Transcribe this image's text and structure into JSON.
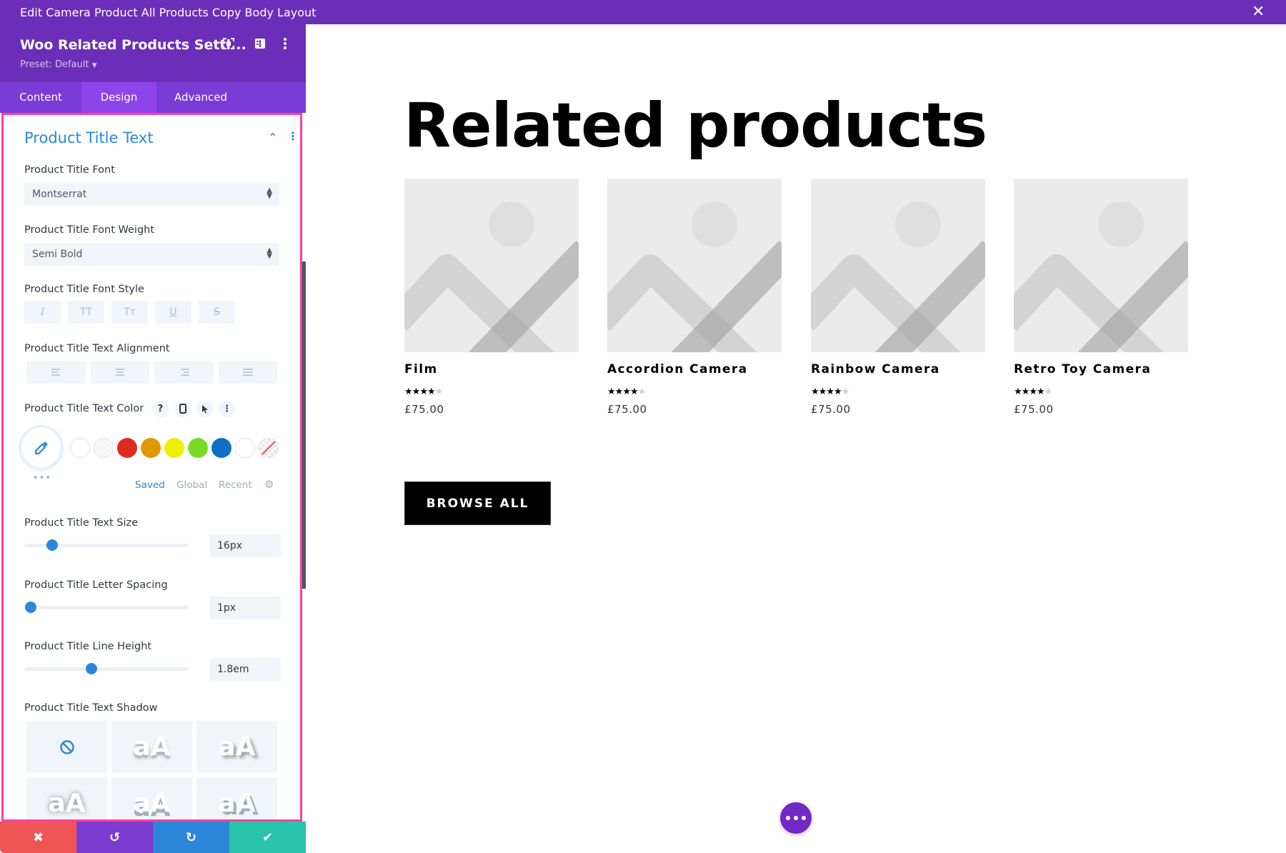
{
  "window": {
    "title": "Edit Camera Product All Products Copy Body Layout",
    "close_icon": "close-icon"
  },
  "sidebar": {
    "module_title": "Woo Related Products Setti...",
    "preset": "Preset: Default",
    "header_icons": [
      "expand-icon",
      "sidebar-toggle-icon",
      "more-vertical-icon"
    ],
    "tabs": [
      {
        "label": "Content",
        "active": false
      },
      {
        "label": "Design",
        "active": true
      },
      {
        "label": "Advanced",
        "active": false
      }
    ],
    "group": {
      "title": "Product Title Text",
      "expanded": true
    },
    "fields": {
      "font": {
        "label": "Product Title Font",
        "value": "Montserrat"
      },
      "font_weight": {
        "label": "Product Title Font Weight",
        "value": "Semi Bold"
      },
      "font_style": {
        "label": "Product Title Font Style",
        "options": [
          "I",
          "TT",
          "Tт",
          "U",
          "S"
        ],
        "option_icons": [
          "italic-icon",
          "uppercase-icon",
          "capitalize-icon",
          "underline-icon",
          "strikethrough-icon"
        ]
      },
      "text_alignment": {
        "label": "Product Title Text Alignment",
        "option_icons": [
          "align-left-icon",
          "align-center-icon",
          "align-right-icon",
          "align-justify-icon"
        ]
      },
      "text_color": {
        "label": "Product Title Text Color",
        "help": "?",
        "swatches": [
          "#ffffff",
          "#f7f7f7",
          "#e02b20",
          "#e09900",
          "#edf000",
          "#7cda24",
          "#0c71c3",
          "#ffffff",
          "transparent"
        ],
        "palette_tabs": [
          "Saved",
          "Global",
          "Recent"
        ],
        "active_palette_tab": "Saved",
        "picker_color": "#2b87da"
      },
      "text_size": {
        "label": "Product Title Text Size",
        "value": "16px",
        "slider_fraction": 0.17
      },
      "letter_spacing": {
        "label": "Product Title Letter Spacing",
        "value": "1px",
        "slider_fraction": 0.04
      },
      "line_height": {
        "label": "Product Title Line Height",
        "value": "1.8em",
        "slider_fraction": 0.41
      },
      "text_shadow": {
        "label": "Product Title Text Shadow",
        "sample": "aA",
        "options": 6,
        "selected": 0
      }
    },
    "footer": {
      "discard": {
        "icon": "close-icon",
        "color": "#ef5555"
      },
      "undo": {
        "icon": "undo-icon",
        "color": "#7e3bd0"
      },
      "redo": {
        "icon": "redo-icon",
        "color": "#2b87da"
      },
      "save": {
        "icon": "check-icon",
        "color": "#29c4a9"
      }
    }
  },
  "main": {
    "heading": "Related products",
    "products": [
      {
        "name": "Film",
        "price": "£75.00",
        "rating": 4,
        "max_rating": 5
      },
      {
        "name": "Accordion Camera",
        "price": "£75.00",
        "rating": 4,
        "max_rating": 5
      },
      {
        "name": "Rainbow Camera",
        "price": "£75.00",
        "rating": 4,
        "max_rating": 5
      },
      {
        "name": "Retro Toy Camera",
        "price": "£75.00",
        "rating": 4,
        "max_rating": 5
      }
    ],
    "browse_button": "BROWSE ALL",
    "fab_icon": "more-horizontal-icon"
  },
  "colors": {
    "brand_purple": "#6c2eb9",
    "tab_bar": "#7b3bd6",
    "tab_active": "#8e44eb",
    "accent_blue": "#2b87da",
    "highlight_border": "#ff3f9c"
  }
}
